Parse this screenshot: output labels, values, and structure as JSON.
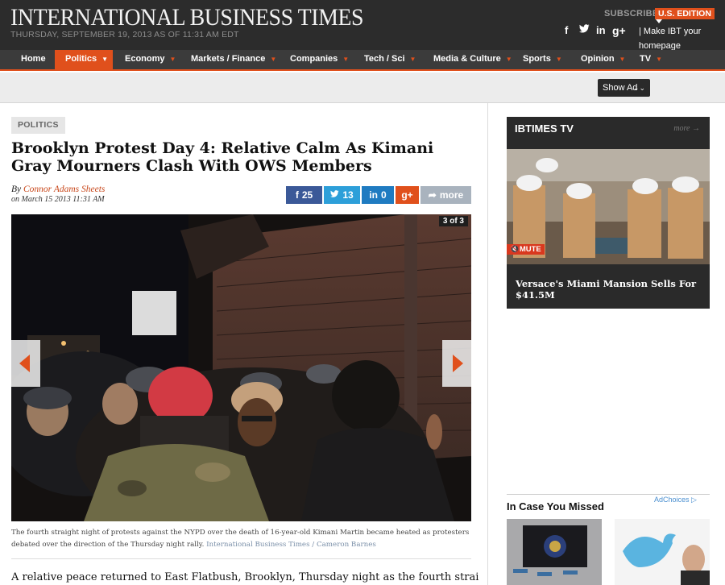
{
  "masthead": {
    "logo": "INTERNATIONAL BUSINESS TIMES",
    "dateline": "THURSDAY, SEPTEMBER 19, 2013 AS OF 11:31 AM EDT",
    "subscribe": "SUBSCRIBE",
    "edition": "U.S. EDITION",
    "social": {
      "facebook": "f",
      "twitter": "t",
      "linkedin": "in",
      "googleplus": "g+"
    },
    "make_homepage": "| Make IBT your homepage"
  },
  "nav": {
    "items": [
      {
        "label": "Home"
      },
      {
        "label": "Politics"
      },
      {
        "label": "Economy"
      },
      {
        "label": "Markets / Finance"
      },
      {
        "label": "Companies"
      },
      {
        "label": "Tech / Sci"
      },
      {
        "label": "Media & Culture"
      },
      {
        "label": "Sports"
      },
      {
        "label": "Opinion"
      },
      {
        "label": "TV"
      }
    ],
    "active": "Politics",
    "accent_color": "#e0501c"
  },
  "adbar": {
    "show_ad_label": "Show Ad"
  },
  "article": {
    "tag": "POLITICS",
    "headline": "Brooklyn Protest Day 4: Relative Calm As Kimani Gray Mourners Clash With OWS Members",
    "byline_prefix": "By",
    "author": "Connor Adams Sheets",
    "posted": "on March 15 2013 11:31 AM",
    "share": {
      "facebook_count": "25",
      "twitter_count": "13",
      "linkedin_count": "0",
      "googleplus_label": "g+",
      "more_label": "more"
    },
    "slide_counter": "3 of 3",
    "caption": "The fourth straight night of protests against the NYPD over the death of 16-year-old Kimani Martin became heated as protesters debated over the direction of the Thursday night rally.",
    "caption_credit": "International Business Times / Cameron Barnes",
    "lede": "A relative peace returned to East Flatbush, Brooklyn, Thursday night as the fourth straight day of"
  },
  "sidebar": {
    "tv": {
      "title": "IBTIMES TV",
      "more": "more",
      "mute_label": "MUTE",
      "video_caption": "Versace's Miami Mansion Sells For $41.5M"
    },
    "adchoices": "AdChoices",
    "in_case_you_missed": "In Case You Missed"
  }
}
